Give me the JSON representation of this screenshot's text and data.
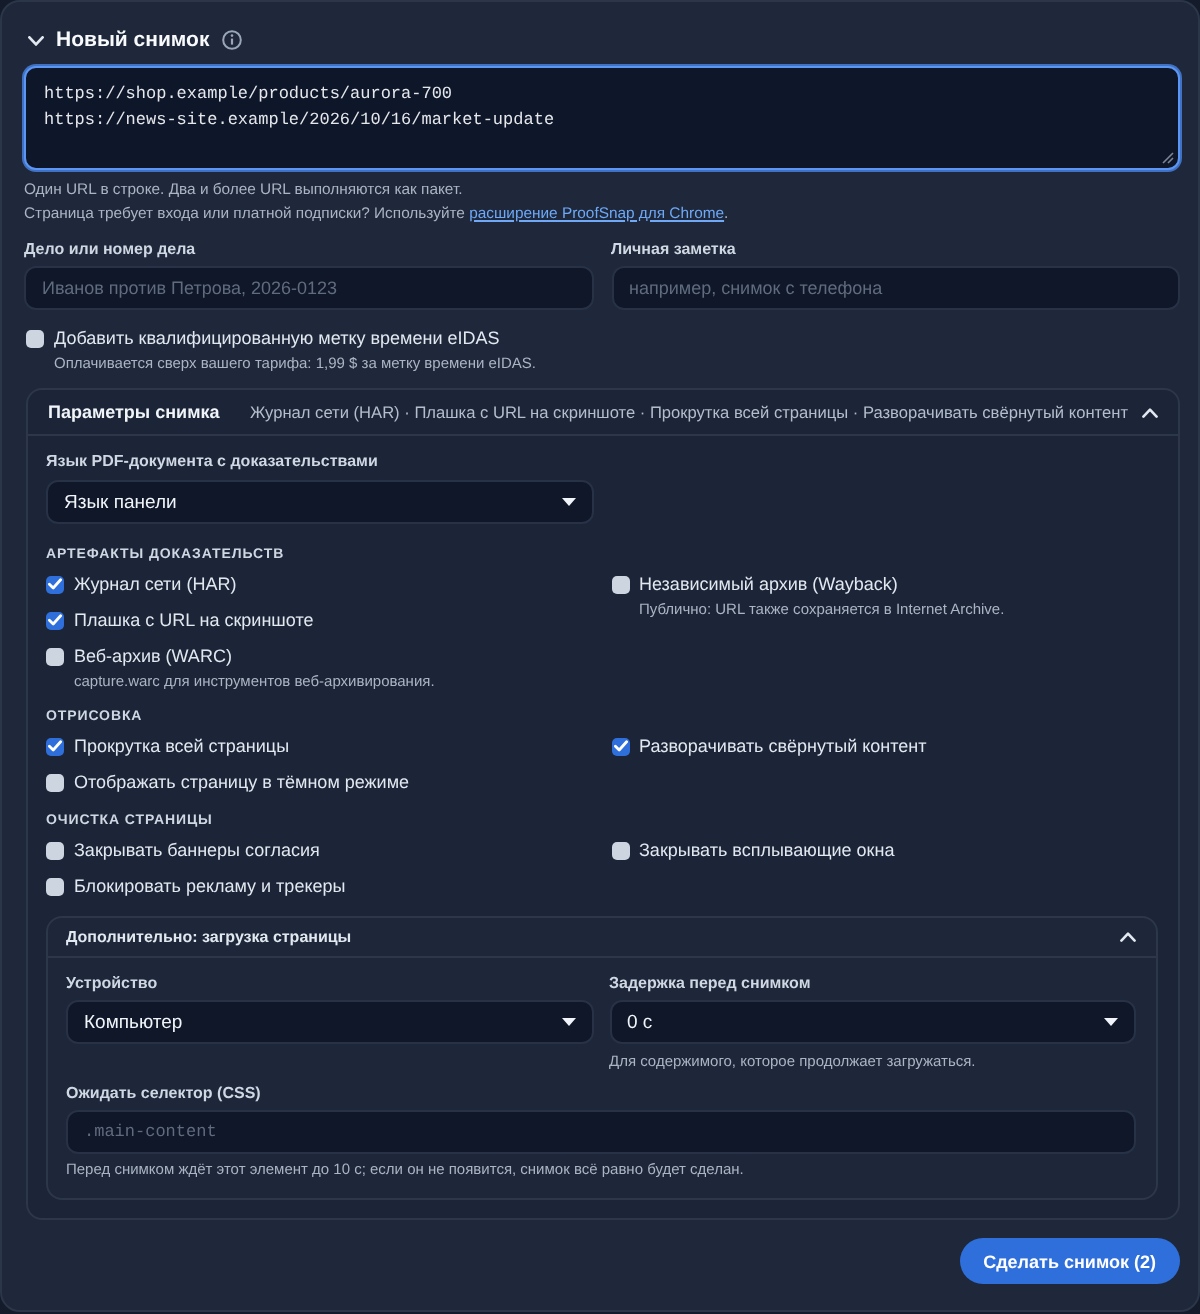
{
  "header": {
    "title": "Новый снимок",
    "expanded": true
  },
  "urls": {
    "value": "https://shop.example/products/aurora-700\nhttps://news-site.example/2026/10/16/market-update",
    "focused": true
  },
  "hints": [
    {
      "text": "Один URL в строке. Два и более URL выполняются как пакет."
    },
    {
      "text": "Страница требует входа или платной подписки? Используйте ",
      "link": "расширение ProofSnap для Chrome",
      "after": "."
    }
  ],
  "fields": [
    {
      "label": "Дело или номер дела",
      "placeholder": "Иванов против Петрова, 2026-0123"
    },
    {
      "label": "Личная заметка",
      "placeholder": "например, снимок с телефона"
    }
  ],
  "eidas": {
    "label": "Добавить квалифицированную метку времени eIDAS",
    "checked": false,
    "note": "Оплачивается сверх вашего тарифа: 1,99 $ за метку времени eIDAS."
  },
  "options": {
    "title": "Параметры снимка",
    "summary": "Журнал сети (HAR) · Плашка с URL на скриншоте · Прокрутка всей страницы · Разворачивать свёрнутый контент",
    "expanded": true,
    "pdf_language": {
      "label": "Язык PDF-документа с доказательствами",
      "value": "Язык панели"
    },
    "groups": [
      {
        "heading": "АРТЕФАКТЫ ДОКАЗАТЕЛЬСТВ",
        "columns": [
          [
            {
              "label": "Журнал сети (HAR)",
              "checked": true
            },
            {
              "label": "Плашка с URL на скриншоте",
              "checked": true
            },
            {
              "label": "Веб-архив (WARC)",
              "checked": false,
              "note": "capture.warc для инструментов веб-архивирования."
            }
          ],
          [
            {
              "label": "Независимый архив (Wayback)",
              "checked": false,
              "note": "Публично: URL также сохраняется в Internet Archive."
            }
          ]
        ]
      },
      {
        "heading": "ОТРИСОВКА",
        "columns": [
          [
            {
              "label": "Прокрутка всей страницы",
              "checked": true
            },
            {
              "label": "Отображать страницу в тёмном режиме",
              "checked": false
            }
          ],
          [
            {
              "label": "Разворачивать свёрнутый контент",
              "checked": true
            }
          ]
        ]
      },
      {
        "heading": "ОЧИСТКА СТРАНИЦЫ",
        "columns": [
          [
            {
              "label": "Закрывать баннеры согласия",
              "checked": false
            },
            {
              "label": "Блокировать рекламу и трекеры",
              "checked": false
            }
          ],
          [
            {
              "label": "Закрывать всплывающие окна",
              "checked": false
            }
          ]
        ]
      }
    ],
    "advanced": {
      "title": "Дополнительно: загрузка страницы",
      "expanded": true,
      "device": {
        "label": "Устройство",
        "value": "Компьютер"
      },
      "delay": {
        "label": "Задержка перед снимком",
        "value": "0 с",
        "hint": "Для содержимого, которое продолжает загружаться."
      },
      "selector": {
        "label": "Ожидать селектор (CSS)",
        "placeholder": ".main-content",
        "hint": "Перед снимком ждёт этот элемент до 10 с; если он не появится, снимок всё равно будет сделан."
      }
    }
  },
  "submit": {
    "label": "Сделать снимок (2)"
  }
}
